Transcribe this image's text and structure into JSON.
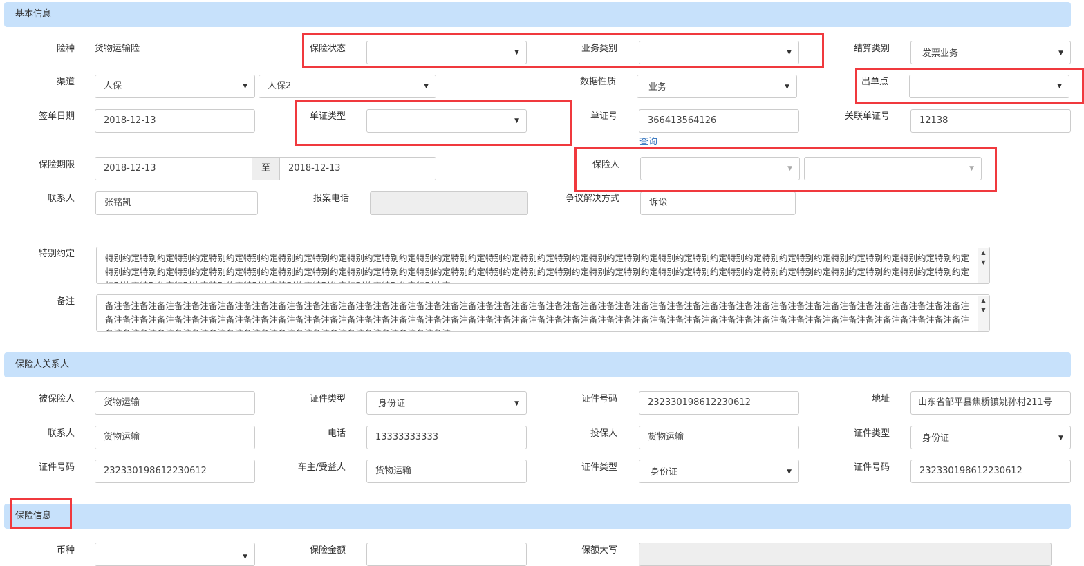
{
  "sections": {
    "basic": "基本信息",
    "relations": "保险人关系人",
    "insurance": "保险信息"
  },
  "basic": {
    "insurance_type_label": "险种",
    "insurance_type_value": "货物运输险",
    "status_label": "保险状态",
    "status_value": "",
    "business_type_label": "业务类别",
    "business_type_value": "",
    "settle_type_label": "结算类别",
    "settle_type_value": "发票业务",
    "channel_label": "渠道",
    "channel_value1": "人保",
    "channel_value2": "人保2",
    "data_nature_label": "数据性质",
    "data_nature_value": "业务",
    "issue_point_label": "出单点",
    "issue_point_value": "",
    "sign_date_label": "签单日期",
    "sign_date_value": "2018-12-13",
    "doc_type_label": "单证类型",
    "doc_type_value": "",
    "doc_no_label": "单证号",
    "doc_no_value": "366413564126",
    "query_link": "查询",
    "related_doc_label": "关联单证号",
    "related_doc_value": "12138",
    "period_label": "保险期限",
    "period_start": "2018-12-13",
    "period_to": "至",
    "period_end": "2018-12-13",
    "insurer_label": "保险人",
    "insurer_value1": "",
    "insurer_value2": "",
    "contact_label": "联系人",
    "contact_value": "张铭凯",
    "report_phone_label": "报案电话",
    "report_phone_value": "",
    "dispute_label": "争议解决方式",
    "dispute_value": "诉讼",
    "special_label": "特别约定",
    "special_unit": "特别约定",
    "special_repeat": 60,
    "remark_label": "备注",
    "remark_unit": "备注",
    "remark_repeat": 120
  },
  "relations": {
    "insured_label": "被保险人",
    "insured_value": "货物运输",
    "id_type1_label": "证件类型",
    "id_type1_value": "身份证",
    "id_no1_label": "证件号码",
    "id_no1_value": "232330198612230612",
    "address_label": "地址",
    "address_value": "山东省邹平县焦桥镇姚孙村211号",
    "contact_label": "联系人",
    "contact_value": "货物运输",
    "phone_label": "电话",
    "phone_value": "13333333333",
    "applicant_label": "投保人",
    "applicant_value": "货物运输",
    "id_type2_label": "证件类型",
    "id_type2_value": "身份证",
    "id_no2_label": "证件号码",
    "id_no2_value": "232330198612230612",
    "owner_label": "车主/受益人",
    "owner_value": "货物运输",
    "id_type3_label": "证件类型",
    "id_type3_value": "身份证",
    "id_no3_label": "证件号码",
    "id_no3_value": "232330198612230612"
  },
  "insurance": {
    "currency_label": "币种",
    "currency_value": "",
    "amount_label": "保险金额",
    "amount_value": "",
    "amount_words_label": "保额大写",
    "amount_words_value": ""
  },
  "colors": {
    "section_bg": "#c7e1fb",
    "highlight": "#f0393e",
    "link": "#2a6ebb"
  }
}
